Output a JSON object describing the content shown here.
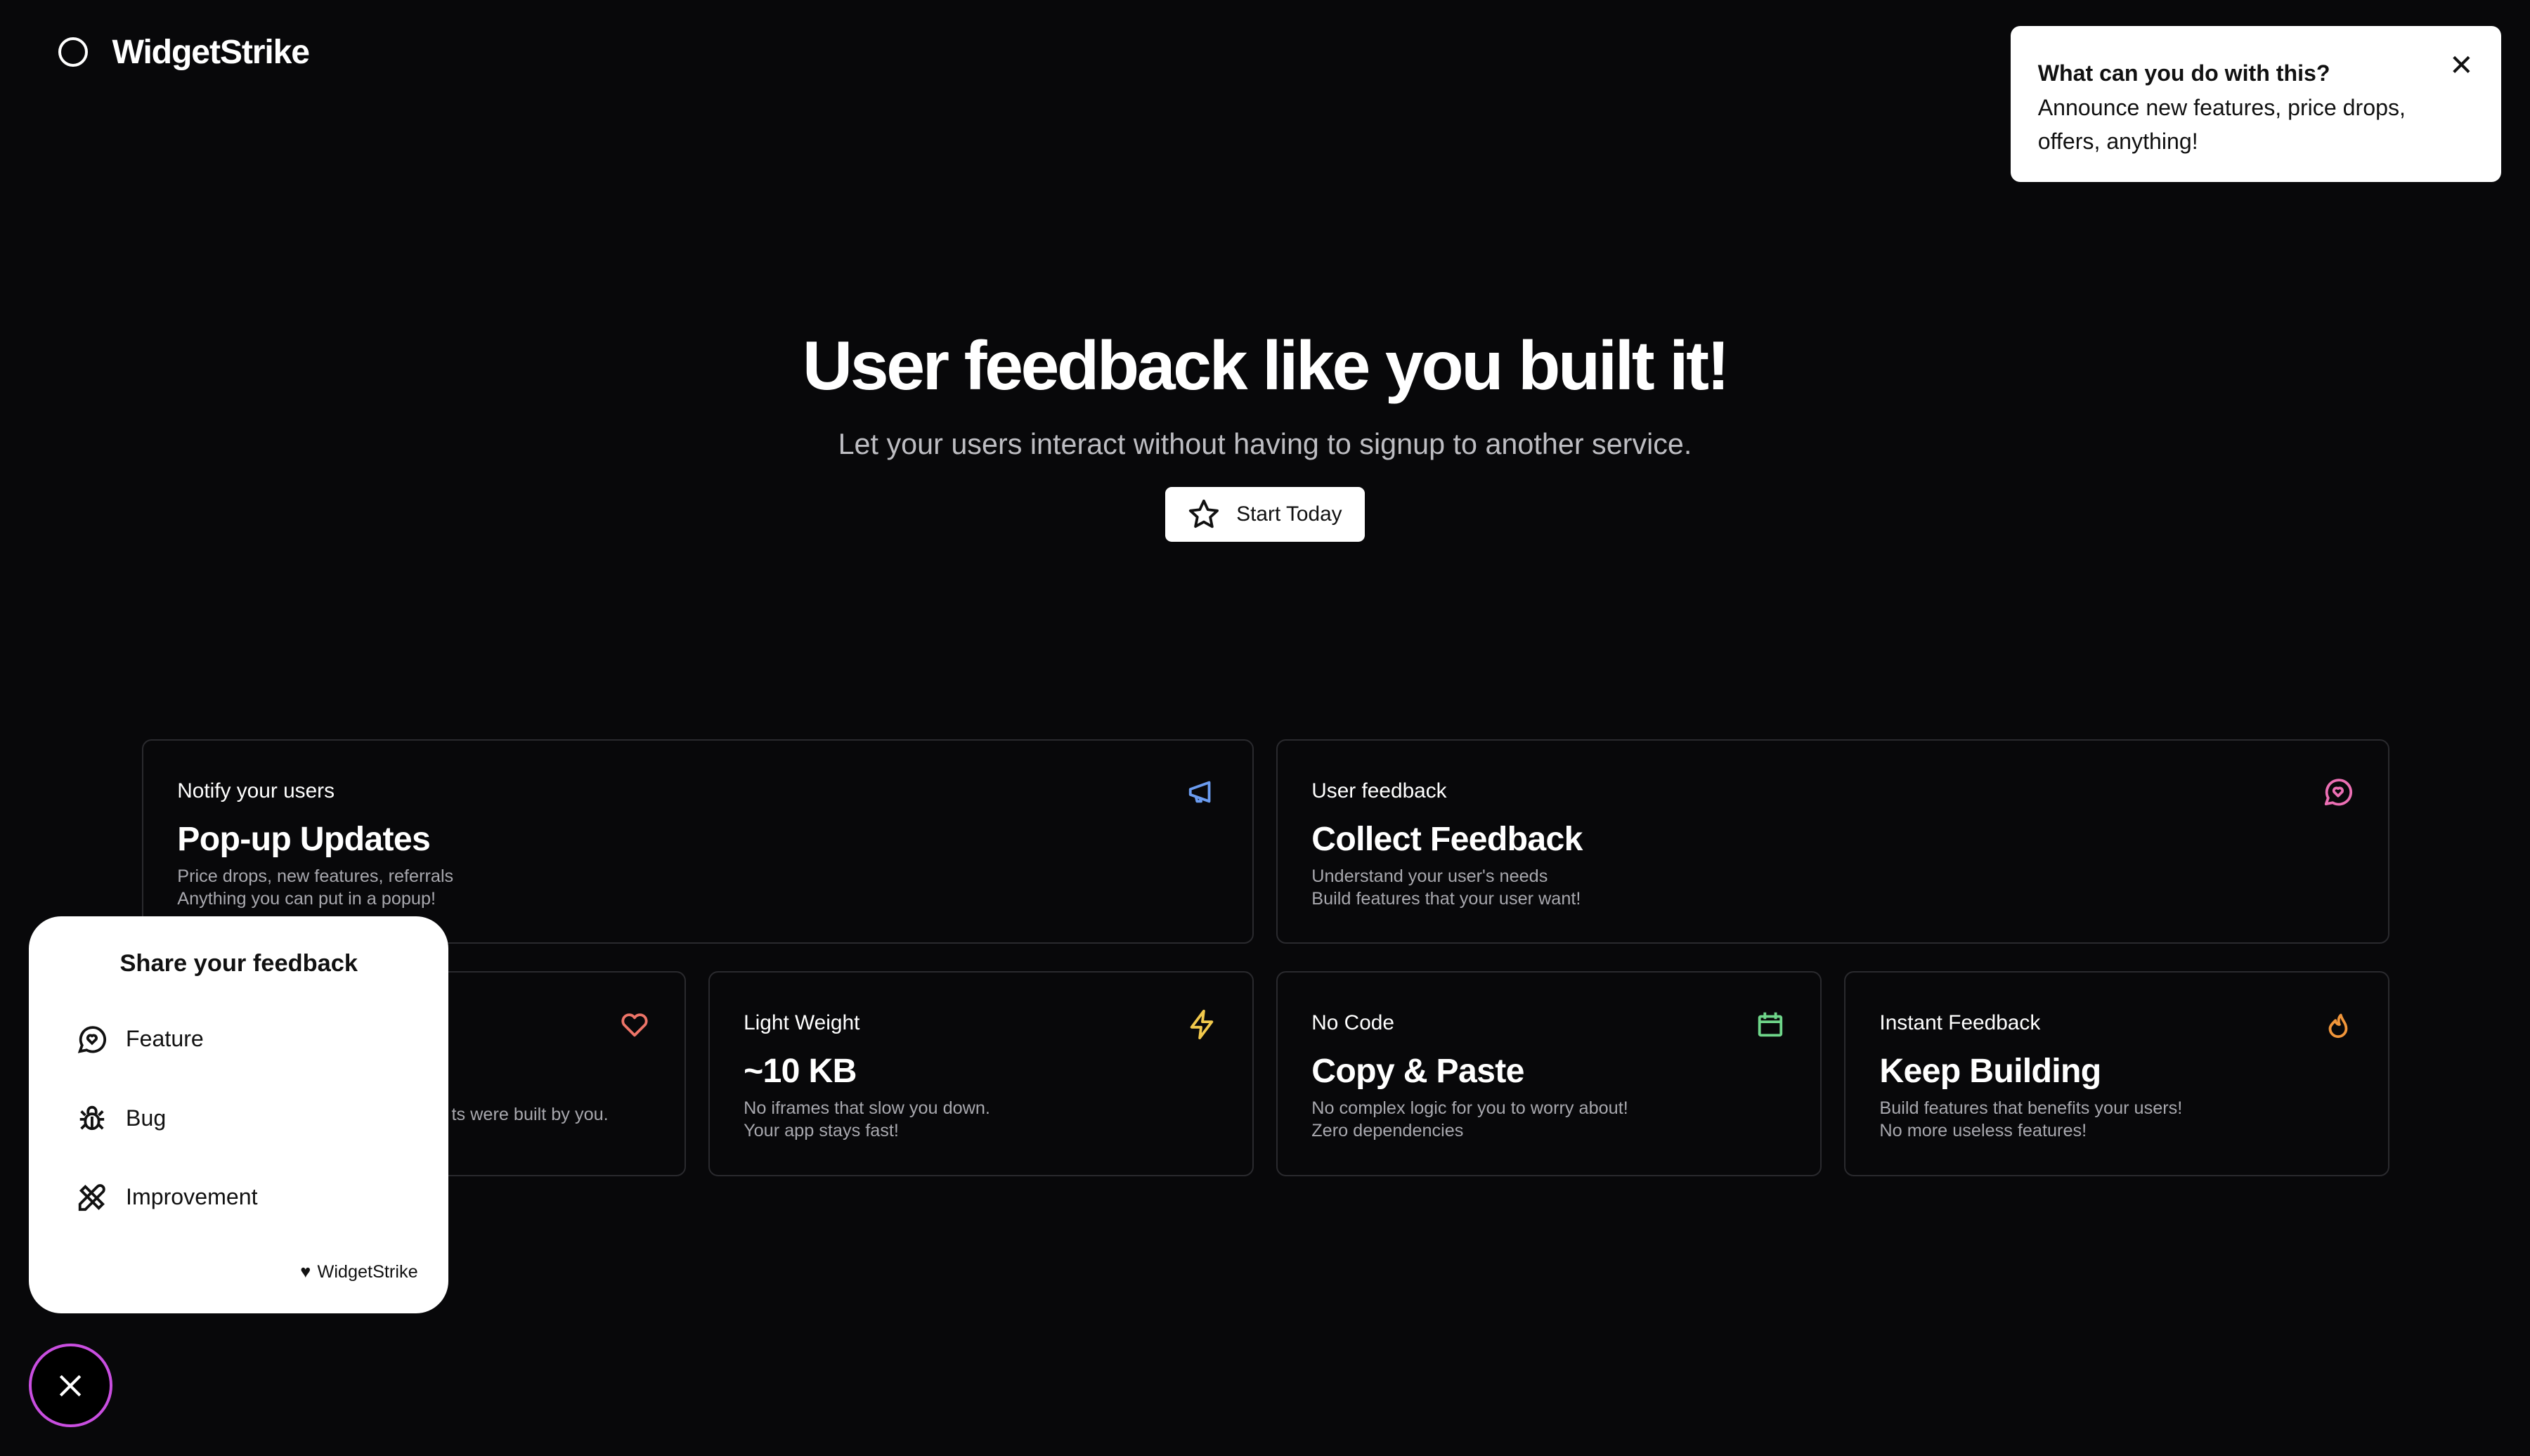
{
  "brand": "WidgetStrike",
  "toast": {
    "title": "What can you do with this?",
    "body": "Announce new features, price drops, offers, anything!"
  },
  "hero": {
    "title": "User feedback like you built it!",
    "subtitle": "Let your users interact without having to signup to another service.",
    "cta": "Start Today"
  },
  "cards": [
    {
      "tag": "Notify your users",
      "title": "Pop-up Updates",
      "lines": [
        "Price drops, new features, referrals",
        "Anything you can put in a popup!"
      ],
      "icon": "megaphone-icon",
      "color": "#6b9cf0"
    },
    {
      "tag": "User feedback",
      "title": "Collect Feedback",
      "lines": [
        "Understand your user's needs",
        "Build features that your user want!"
      ],
      "icon": "message-heart-icon",
      "color": "#ec6fb4"
    },
    {
      "tag": "",
      "title": "",
      "lines": [
        "ts were built by you.",
        ""
      ],
      "icon": "heart-icon",
      "color": "#ee7468"
    },
    {
      "tag": "Light Weight",
      "title": "~10 KB",
      "lines": [
        "No iframes that slow you down.",
        "Your app stays fast!"
      ],
      "icon": "bolt-icon",
      "color": "#f2c94c"
    },
    {
      "tag": "No Code",
      "title": "Copy & Paste",
      "lines": [
        "No complex logic for you to worry about!",
        "Zero dependencies"
      ],
      "icon": "calendar-icon",
      "color": "#6fd68a"
    },
    {
      "tag": "Instant Feedback",
      "title": "Keep Building",
      "lines": [
        "Build features that benefits your users!",
        "No more useless features!"
      ],
      "icon": "flame-icon",
      "color": "#f0953a"
    }
  ],
  "widget": {
    "title": "Share your feedback",
    "items": [
      "Feature",
      "Bug",
      "Improvement"
    ],
    "footer": "WidgetStrike",
    "accent": "#c94ee0"
  }
}
